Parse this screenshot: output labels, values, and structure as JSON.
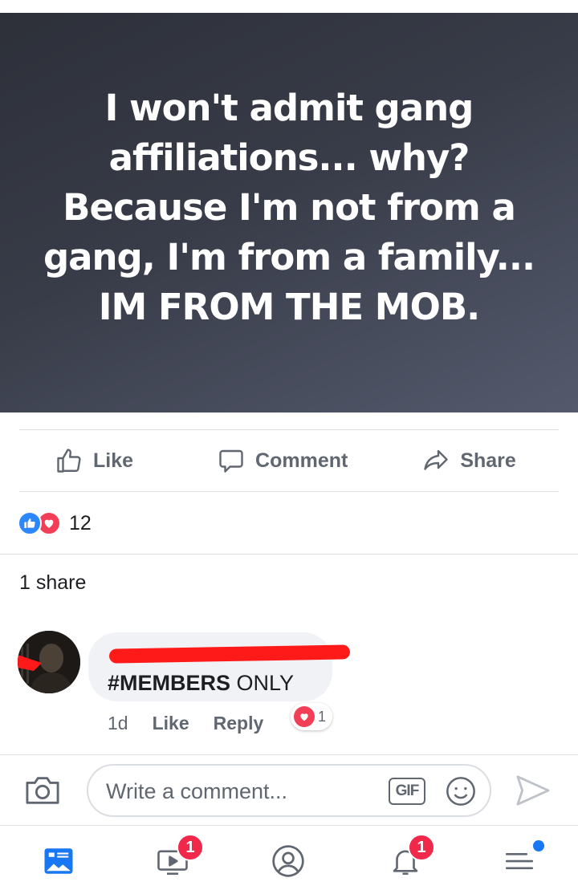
{
  "post": {
    "image_text_lines": [
      "I won't admit gang",
      "affiliations... why?",
      "Because I'm not from a",
      "gang, I'm from a family...",
      "IM FROM THE MOB."
    ]
  },
  "actions": {
    "like": "Like",
    "comment": "Comment",
    "share": "Share"
  },
  "reactions": {
    "count": "12"
  },
  "shares": {
    "label": "1 share"
  },
  "comment": {
    "hashtag": "#MEMBERS",
    "text_rest": " ONLY",
    "time": "1d",
    "like": "Like",
    "reply": "Reply",
    "love_count": "1"
  },
  "composer": {
    "placeholder": "Write a comment...",
    "gif_label": "GIF"
  },
  "tabbar": {
    "watch_badge": "1",
    "notifications_badge": "1"
  },
  "colors": {
    "accent": "#1877f2",
    "like_blue": "#2d88ff",
    "love_red": "#f33e58",
    "badge_red": "#f02849",
    "secondary_text": "#606770",
    "redaction": "#ff1a1a"
  }
}
